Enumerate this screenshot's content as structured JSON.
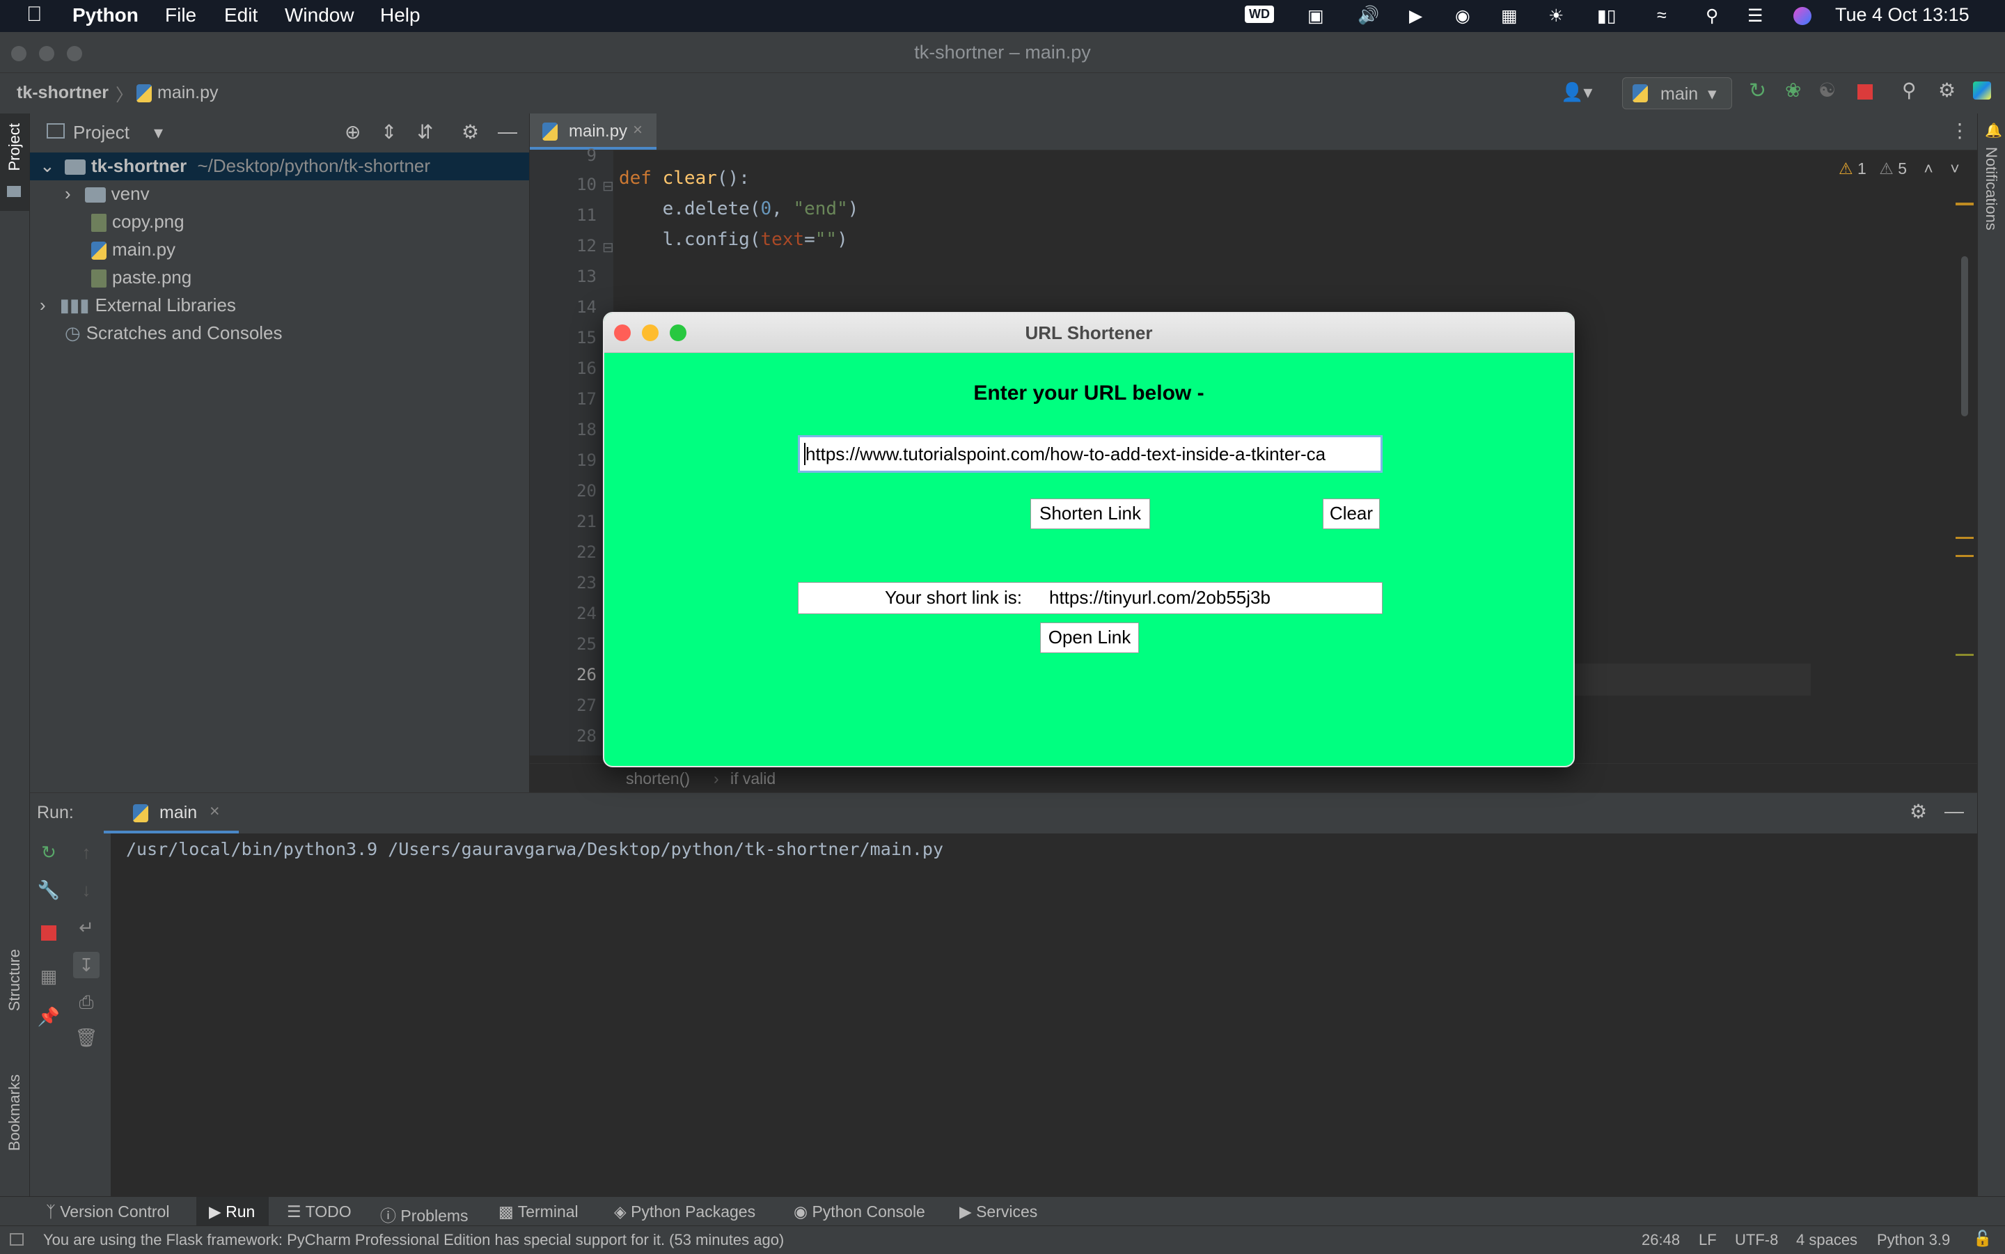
{
  "menubar": {
    "app_name": "Python",
    "items": [
      "File",
      "Edit",
      "Window",
      "Help"
    ],
    "status_icons": [
      "wd-icon",
      "display-icon",
      "volume-icon",
      "play-icon",
      "user-icon",
      "keyboard-icon",
      "brightness-icon",
      "battery-icon",
      "wifi-icon",
      "search-icon",
      "control-center-icon",
      "siri-icon"
    ],
    "clock": "Tue 4 Oct  13:15"
  },
  "window": {
    "title": "tk-shortner – main.py"
  },
  "navbar": {
    "project": "tk-shortner",
    "file": "main.py",
    "run_config": "main"
  },
  "project_panel": {
    "title": "Project",
    "tree": [
      {
        "label": "tk-shortner",
        "path": "~/Desktop/python/tk-shortner"
      },
      {
        "label": "venv"
      },
      {
        "label": "copy.png"
      },
      {
        "label": "main.py"
      },
      {
        "label": "paste.png"
      },
      {
        "label": "External Libraries"
      },
      {
        "label": "Scratches and Consoles"
      }
    ]
  },
  "left_stripe": {
    "project": "Project",
    "structure": "Structure",
    "bookmarks": "Bookmarks"
  },
  "right_stripe": {
    "notifications": "Notifications"
  },
  "editor": {
    "tab": "main.py",
    "warnings": "1",
    "weak_warnings": "5",
    "line_numbers": [
      "9",
      "10",
      "11",
      "12",
      "13",
      "14",
      "15",
      "16",
      "17",
      "18",
      "19",
      "20",
      "21",
      "22",
      "23",
      "24",
      "25",
      "26",
      "27",
      "28"
    ],
    "code": {
      "l9_kw": "def ",
      "l9_fn": "clear",
      "l9_rest": "():",
      "l10_a": "    e.delete(",
      "l10_num": "0",
      "l10_b": ", ",
      "l10_str": "\"end\"",
      "l10_c": ")",
      "l11_a": "    l.config(",
      "l11_kw": "text",
      "l11_b": "=",
      "l11_str": "\"\"",
      "l11_c": ")"
    },
    "breadcrumb": [
      "shorten()",
      "if valid"
    ]
  },
  "run_panel": {
    "label": "Run:",
    "tab": "main",
    "output": "/usr/local/bin/python3.9 /Users/gauravgarwa/Desktop/python/tk-shortner/main.py"
  },
  "bottom_tabs": [
    "Version Control",
    "Run",
    "TODO",
    "Problems",
    "Terminal",
    "Python Packages",
    "Python Console",
    "Services"
  ],
  "status": {
    "message": "You are using the Flask framework: PyCharm Professional Edition has special support for it. (53 minutes ago)",
    "position": "26:48",
    "line_sep": "LF",
    "encoding": "UTF-8",
    "indent": "4 spaces",
    "interpreter": "Python 3.9"
  },
  "tk_app": {
    "title": "URL Shortener",
    "heading": "Enter your URL below -",
    "url_value": "https://www.tutorialspoint.com/how-to-add-text-inside-a-tkinter-ca",
    "shorten_label": "Shorten Link",
    "clear_label": "Clear",
    "result_prefix": "Your short link is:",
    "result_link": "https://tinyurl.com/2ob55j3b",
    "open_label": "Open Link",
    "bg_color": "#00ff80"
  }
}
